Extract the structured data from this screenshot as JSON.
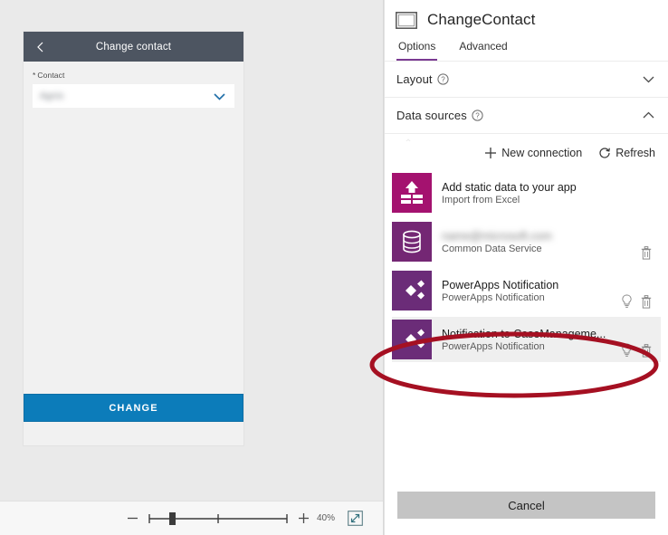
{
  "canvas": {
    "phone": {
      "header": {
        "back_icon": "back-chevron-icon",
        "title": "Change contact"
      },
      "form": {
        "required_mark": "*",
        "field_label": "Contact",
        "combo_value": "Agnis",
        "caret_icon": "chevron-down-icon"
      },
      "primary_button": "CHANGE"
    },
    "zoom_bar": {
      "minus_icon": "minus-icon",
      "plus_icon": "plus-icon",
      "zoom_level": "40%",
      "fit_icon": "fit-to-screen-icon"
    }
  },
  "panel": {
    "screen_icon": "screen-icon",
    "title": "ChangeContact",
    "tabs": [
      {
        "label": "Options",
        "active": true
      },
      {
        "label": "Advanced",
        "active": false
      }
    ],
    "sections": [
      {
        "label": "Layout",
        "help_icon": "help-circle-icon",
        "caret_icon": "chevron-down-icon",
        "expanded": false
      },
      {
        "label": "Data sources",
        "help_icon": "help-circle-icon",
        "caret_icon": "chevron-up-icon",
        "expanded": true
      }
    ],
    "data_sources": {
      "actions": [
        {
          "label": "New connection",
          "icon": "plus-icon"
        },
        {
          "label": "Refresh",
          "icon": "refresh-icon"
        }
      ],
      "items": [
        {
          "primary": "Add static data to your app",
          "secondary": "Import from Excel",
          "tile_icon": "excel-upload-icon",
          "tile_color": "#A4126F",
          "blurred": false,
          "selected": false,
          "has_bulb": false,
          "has_trash": false
        },
        {
          "primary": "name@microsoft.com",
          "secondary": "Common Data Service",
          "tile_icon": "database-icon",
          "tile_color": "#742774",
          "blurred": true,
          "selected": false,
          "has_bulb": false,
          "has_trash": true
        },
        {
          "primary": "PowerApps Notification",
          "secondary": "PowerApps Notification",
          "tile_icon": "powerapps-notification-icon",
          "tile_color": "#6B2C78",
          "blurred": false,
          "selected": false,
          "has_bulb": true,
          "has_trash": true
        },
        {
          "primary": "Notification to CaseManageme...",
          "secondary": "PowerApps Notification",
          "tile_icon": "powerapps-notification-icon",
          "tile_color": "#6B2C78",
          "blurred": false,
          "selected": true,
          "has_bulb": true,
          "has_trash": true
        }
      ]
    },
    "cancel_button": "Cancel"
  },
  "annotation": {
    "shape": "ellipse-highlight",
    "color": "#A51022"
  }
}
